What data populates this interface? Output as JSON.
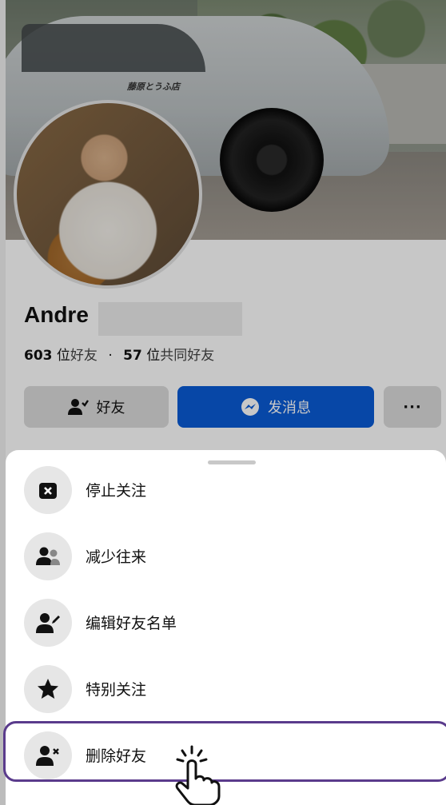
{
  "profile": {
    "name": "Andre",
    "friend_count": "603",
    "friend_unit": "位",
    "friend_label": "好友",
    "separator": "·",
    "mutual_count": "57",
    "mutual_unit": "位",
    "mutual_label": "共同好友",
    "car_sticker_text": "藤原とうふ店"
  },
  "actions": {
    "friends_label": "好友",
    "message_label": "发消息",
    "more_label": "···"
  },
  "menu": {
    "items": [
      {
        "label": "停止关注",
        "icon": "unfollow-icon"
      },
      {
        "label": "减少往来",
        "icon": "people-icon"
      },
      {
        "label": "编辑好友名单",
        "icon": "edit-friend-icon"
      },
      {
        "label": "特别关注",
        "icon": "star-icon"
      },
      {
        "label": "删除好友",
        "icon": "remove-friend-icon"
      }
    ]
  },
  "colors": {
    "primary": "#0a5bd6",
    "highlight_border": "#5a3b8c",
    "sheet_bg": "#ffffff",
    "icon_circle": "#e6e6e6"
  }
}
